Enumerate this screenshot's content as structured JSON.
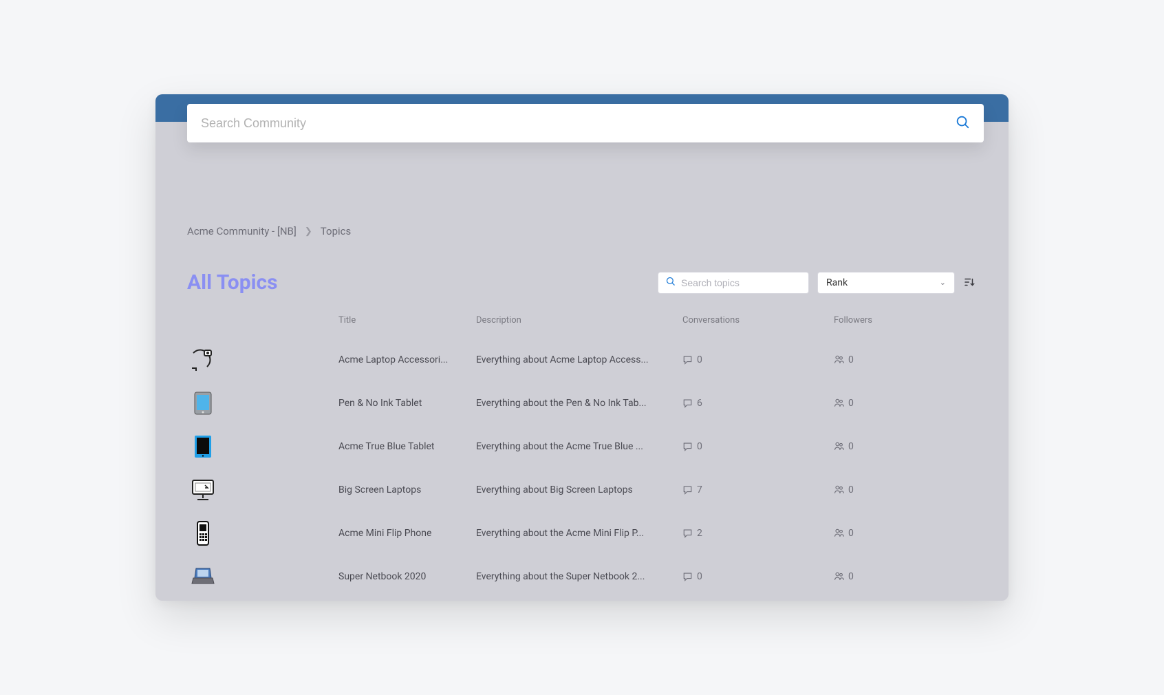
{
  "search": {
    "placeholder": "Search Community"
  },
  "breadcrumb": {
    "root": "Acme Community - [NB]",
    "current": "Topics"
  },
  "page_title": "All Topics",
  "topics_search": {
    "placeholder": "Search topics"
  },
  "sort": {
    "label": "Rank"
  },
  "columns": {
    "title": "Title",
    "description": "Description",
    "conversations": "Conversations",
    "followers": "Followers"
  },
  "rows": [
    {
      "icon": "accessory-icon",
      "title": "Acme Laptop Accessori...",
      "description": "Everything about Acme Laptop Access...",
      "conversations": "0",
      "followers": "0"
    },
    {
      "icon": "tablet-light-icon",
      "title": "Pen & No Ink Tablet",
      "description": "Everything about the Pen & No Ink Tab...",
      "conversations": "6",
      "followers": "0"
    },
    {
      "icon": "tablet-dark-icon",
      "title": "Acme True Blue Tablet",
      "description": "Everything about the Acme True Blue ...",
      "conversations": "0",
      "followers": "0"
    },
    {
      "icon": "desktop-icon",
      "title": "Big Screen Laptops",
      "description": "Everything about Big Screen Laptops",
      "conversations": "7",
      "followers": "0"
    },
    {
      "icon": "phone-icon",
      "title": "Acme Mini Flip Phone",
      "description": "Everything about the Acme Mini Flip P...",
      "conversations": "2",
      "followers": "0"
    },
    {
      "icon": "netbook-icon",
      "title": "Super Netbook 2020",
      "description": "Everything about the Super Netbook 2...",
      "conversations": "0",
      "followers": "0"
    }
  ]
}
